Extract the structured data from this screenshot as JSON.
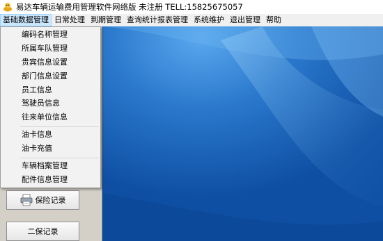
{
  "window": {
    "title": "易达车辆运输费用管理软件网络版 未注册 TELL:15825675057"
  },
  "menubar": {
    "items": [
      "基础数据管理",
      "日常处理",
      "到期管理",
      "查询统计报表管理",
      "系统维护",
      "退出管理",
      "帮助"
    ]
  },
  "dropdown": {
    "groups": [
      [
        "编码名称管理",
        "所属车队管理",
        "贵宾信息设置",
        "部门信息设置",
        "员工信息",
        "驾驶员信息",
        "往来单位信息"
      ],
      [
        "油卡信息",
        "油卡充值"
      ],
      [
        "车辆档案管理",
        "配件信息管理"
      ]
    ]
  },
  "sidebar": {
    "buttons": [
      "保险记录",
      "二保记录"
    ]
  },
  "colors": {
    "menu_highlight": "#cce8ff",
    "desktop": "#1b63b6",
    "panel": "#d4d0c8"
  }
}
